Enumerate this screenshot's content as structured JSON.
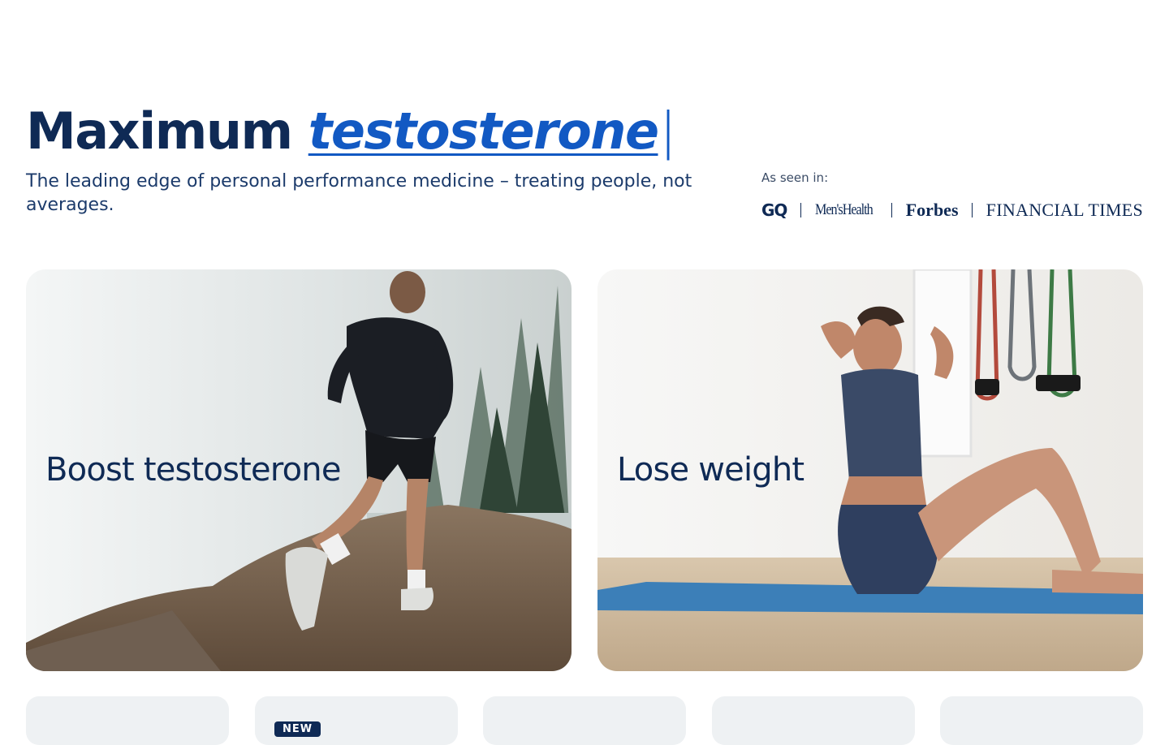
{
  "hero": {
    "headline_prefix": "Maximum",
    "headline_accent": "testosterone",
    "cursor": "|",
    "subline": "The leading edge of personal performance medicine – treating people, not averages."
  },
  "press": {
    "label": "As seen in:",
    "logos": [
      "GQ",
      "Men'sHealth",
      "Forbes",
      "FINANCIAL TIMES"
    ]
  },
  "cards": [
    {
      "title": "Boost testosterone",
      "image": "man-running-on-misty-trail-photo"
    },
    {
      "title": "Lose weight",
      "image": "woman-doing-sit-ups-on-mat-photo"
    }
  ],
  "tiles": {
    "new_badge": "NEW"
  },
  "colors": {
    "navy": "#0f2a55",
    "accent_blue": "#1259c3",
    "tile_bg": "#eef1f3"
  }
}
